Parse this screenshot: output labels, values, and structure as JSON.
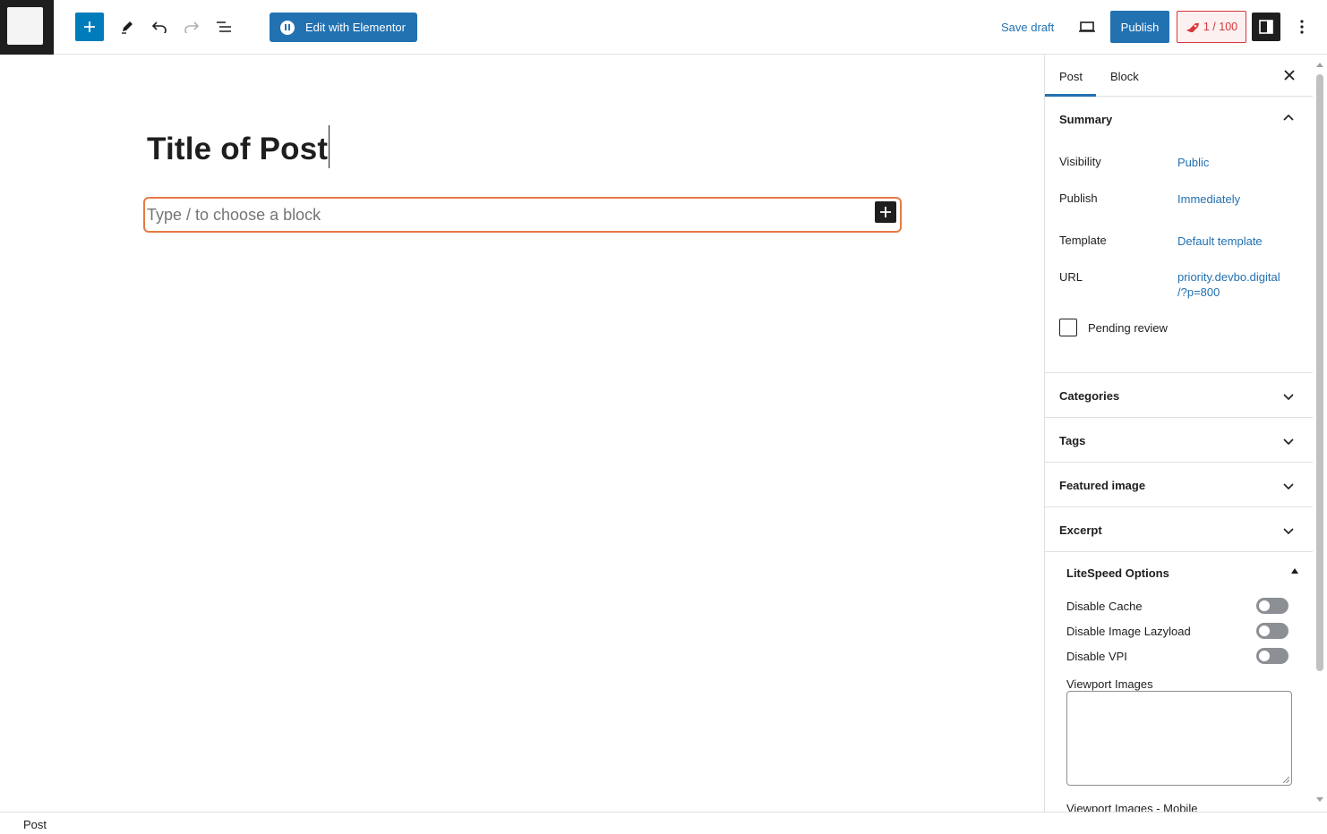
{
  "toolbar": {
    "elementor_label": "Edit with Elementor",
    "save_draft_label": "Save draft",
    "publish_label": "Publish",
    "counter_label": "1 / 100"
  },
  "editor": {
    "post_title": "Title of Post",
    "block_placeholder": "Type / to choose a block"
  },
  "sidebar": {
    "tabs": [
      {
        "label": "Post",
        "active": true
      },
      {
        "label": "Block",
        "active": false
      }
    ],
    "summary": {
      "title": "Summary",
      "rows": [
        {
          "label": "Visibility",
          "value": "Public"
        },
        {
          "label": "Publish",
          "value": "Immediately"
        },
        {
          "label": "Template",
          "value": "Default template"
        },
        {
          "label": "URL",
          "value_line1": "priority.devbo.digital",
          "value_line2": "/?p=800"
        }
      ],
      "pending_review_label": "Pending review",
      "pending_review_checked": false
    },
    "panels": [
      "Categories",
      "Tags",
      "Featured image",
      "Excerpt"
    ],
    "litespeed": {
      "title": "LiteSpeed Options",
      "options": [
        {
          "label": "Disable Cache",
          "enabled": false
        },
        {
          "label": "Disable Image Lazyload",
          "enabled": false
        },
        {
          "label": "Disable VPI",
          "enabled": false
        }
      ],
      "viewport_images_label": "Viewport Images",
      "viewport_images_value": "",
      "viewport_images_mobile_label": "Viewport Images - Mobile"
    }
  },
  "footer": {
    "breadcrumb": "Post"
  },
  "colors": {
    "accent": "#2271b1",
    "wp_blue": "#007cba",
    "block_focus": "#e77a45",
    "counter_red": "#d63638",
    "dark": "#1e1e1e"
  },
  "icons": [
    "wordpress-logo",
    "plus-icon",
    "pencil-icon",
    "undo-icon",
    "redo-icon",
    "list-view-icon",
    "elementor-icon",
    "desktop-preview-icon",
    "rocket-icon",
    "sidebar-toggle-icon",
    "kebab-menu-icon",
    "close-icon",
    "chevron-up-icon",
    "chevron-down-icon",
    "triangle-up-icon"
  ]
}
